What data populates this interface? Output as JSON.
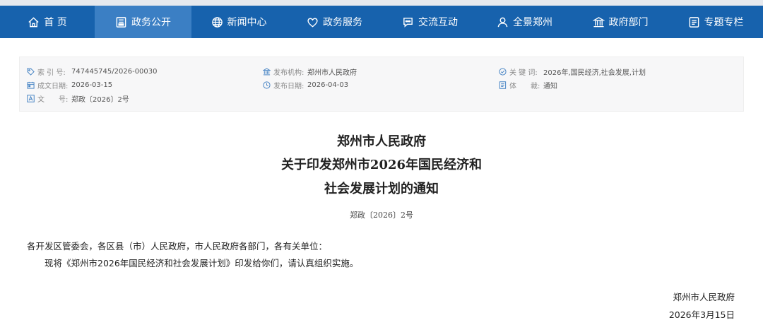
{
  "nav": {
    "items": [
      {
        "label": "首 页",
        "icon": "home-icon"
      },
      {
        "label": "政务公开",
        "icon": "document-icon",
        "active": true
      },
      {
        "label": "新闻中心",
        "icon": "globe-icon"
      },
      {
        "label": "政务服务",
        "icon": "heart-icon"
      },
      {
        "label": "交流互动",
        "icon": "chat-icon"
      },
      {
        "label": "全景郑州",
        "icon": "user-icon"
      },
      {
        "label": "政府部门",
        "icon": "building-icon"
      },
      {
        "label": "专题专栏",
        "icon": "list-icon"
      }
    ],
    "bg_color": "#1762ad",
    "active_color": "#3b7fc4"
  },
  "meta": {
    "index_label": "索 引 号:",
    "index_value": "747445745/2026-00030",
    "org_label": "发布机构:",
    "org_value": "郑州市人民政府",
    "keywords_label": "关 键 词:",
    "keywords_value": "2026年,国民经济,社会发展,计划",
    "created_label": "成文日期:",
    "created_value": "2026-03-15",
    "published_label": "发布日期:",
    "published_value": "2026-04-03",
    "genre_label": "体　　裁:",
    "genre_value": "通知",
    "docno_label": "文　　号:",
    "docno_value": "郑政〔2026〕2号"
  },
  "document": {
    "title_line1": "郑州市人民政府",
    "title_line2": "关于印发郑州市2026年国民经济和",
    "title_line3": "社会发展计划的通知",
    "doc_number": "郑政〔2026〕2号",
    "salutation": "各开发区管委会，各区县（市）人民政府，市人民政府各部门，各有关单位：",
    "paragraph1": "现将《郑州市2026年国民经济和社会发展计划》印发给你们，请认真组织实施。",
    "signature": "郑州市人民政府",
    "date": "2026年3月15日"
  }
}
